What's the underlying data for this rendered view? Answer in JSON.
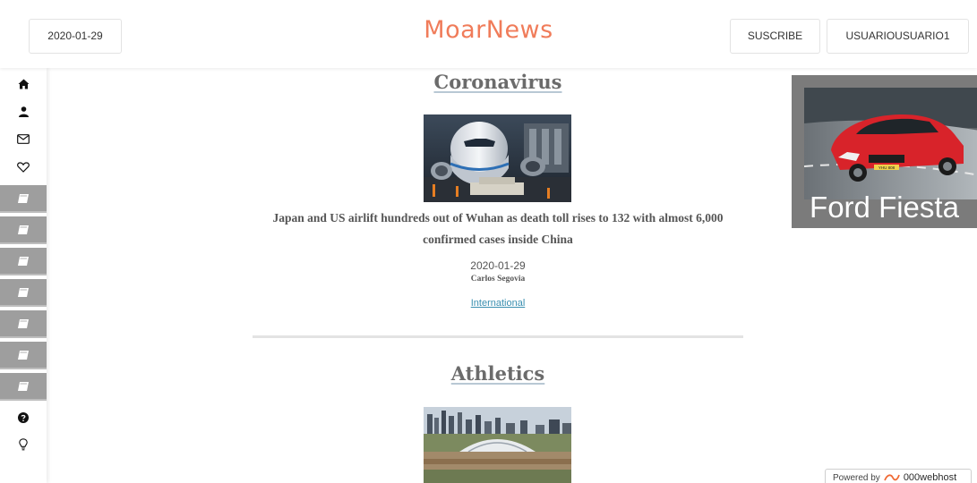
{
  "header": {
    "date_label": "2020-01-29",
    "brand": "MoarNews",
    "subscribe_label": "SUSCRIBE",
    "user_label": "USUARIOUSUARIO1"
  },
  "sidebar": {
    "top_icons": [
      "home-icon",
      "user-icon",
      "envelope-icon",
      "heart-icon"
    ],
    "section_icons": [
      "book-icon",
      "book-icon",
      "book-icon",
      "book-icon",
      "book-icon",
      "book-icon",
      "book-icon"
    ],
    "bottom_icons": [
      "question-circle-icon",
      "lightbulb-icon"
    ]
  },
  "articles": [
    {
      "section": "Coronavirus",
      "headline": "Japan and US airlift hundreds out of Wuhan as death toll rises to 132 with almost 6,000 confirmed cases inside China",
      "date": "2020-01-29",
      "author": "Carlos Segovia",
      "category": "International"
    },
    {
      "section": "Athletics"
    }
  ],
  "ad": {
    "label": "Ford Fiesta",
    "plate": "YHU 808"
  },
  "footer": {
    "powered_prefix": "Powered by",
    "powered_host": "000webhost"
  },
  "colors": {
    "brand": "#f07c5a",
    "sidebar_section": "#9e9e9e",
    "link": "#3a8fb0"
  }
}
